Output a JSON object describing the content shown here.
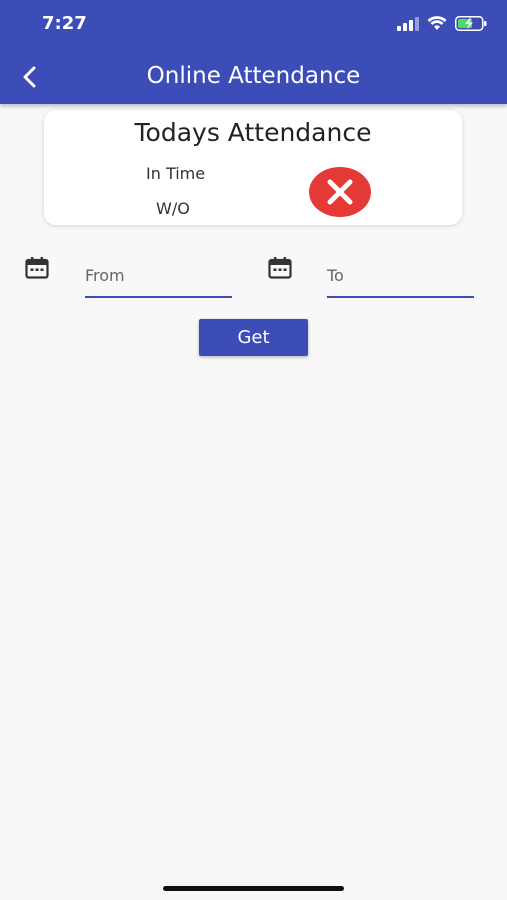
{
  "status_bar": {
    "time": "7:27"
  },
  "header": {
    "title": "Online Attendance",
    "accent_color": "#3d4db7"
  },
  "card": {
    "title": "Todays Attendance",
    "in_time_label": "In Time",
    "in_time_value": "W/O",
    "status_icon": "close-circle-icon",
    "status_color": "#e53935"
  },
  "date_range": {
    "from_label": "From",
    "to_label": "To"
  },
  "get_button": {
    "label": "Get"
  }
}
